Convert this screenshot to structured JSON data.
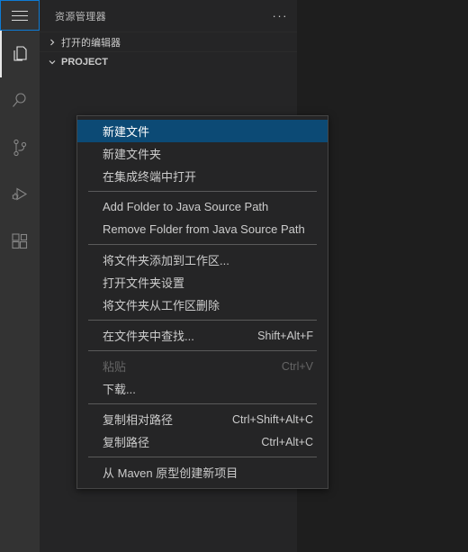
{
  "activitybar": {
    "menu_icon": "hamburger-icon",
    "items": [
      {
        "name": "explorer",
        "icon": "files-icon",
        "active": true
      },
      {
        "name": "search",
        "icon": "search-icon",
        "active": false
      },
      {
        "name": "source-control",
        "icon": "git-branch-icon",
        "active": false
      },
      {
        "name": "run-debug",
        "icon": "run-debug-icon",
        "active": false
      },
      {
        "name": "extensions",
        "icon": "extensions-icon",
        "active": false
      }
    ]
  },
  "sidebar": {
    "title": "资源管理器",
    "actions_label": "···",
    "tree": [
      {
        "label": "打开的编辑器",
        "expanded": false,
        "bold": false
      },
      {
        "label": "PROJECT",
        "expanded": true,
        "bold": true
      }
    ]
  },
  "context_menu": {
    "items": [
      {
        "type": "item",
        "label": "新建文件",
        "shortcut": "",
        "selected": true,
        "disabled": false
      },
      {
        "type": "item",
        "label": "新建文件夹",
        "shortcut": "",
        "selected": false,
        "disabled": false
      },
      {
        "type": "item",
        "label": "在集成终端中打开",
        "shortcut": "",
        "selected": false,
        "disabled": false
      },
      {
        "type": "separator"
      },
      {
        "type": "item",
        "label": "Add Folder to Java Source Path",
        "shortcut": "",
        "selected": false,
        "disabled": false
      },
      {
        "type": "item",
        "label": "Remove Folder from Java Source Path",
        "shortcut": "",
        "selected": false,
        "disabled": false
      },
      {
        "type": "separator"
      },
      {
        "type": "item",
        "label": "将文件夹添加到工作区...",
        "shortcut": "",
        "selected": false,
        "disabled": false
      },
      {
        "type": "item",
        "label": "打开文件夹设置",
        "shortcut": "",
        "selected": false,
        "disabled": false
      },
      {
        "type": "item",
        "label": "将文件夹从工作区删除",
        "shortcut": "",
        "selected": false,
        "disabled": false
      },
      {
        "type": "separator"
      },
      {
        "type": "item",
        "label": "在文件夹中查找...",
        "shortcut": "Shift+Alt+F",
        "selected": false,
        "disabled": false
      },
      {
        "type": "separator"
      },
      {
        "type": "item",
        "label": "粘贴",
        "shortcut": "Ctrl+V",
        "selected": false,
        "disabled": true
      },
      {
        "type": "item",
        "label": "下载...",
        "shortcut": "",
        "selected": false,
        "disabled": false
      },
      {
        "type": "separator"
      },
      {
        "type": "item",
        "label": "复制相对路径",
        "shortcut": "Ctrl+Shift+Alt+C",
        "selected": false,
        "disabled": false
      },
      {
        "type": "item",
        "label": "复制路径",
        "shortcut": "Ctrl+Alt+C",
        "selected": false,
        "disabled": false
      },
      {
        "type": "separator"
      },
      {
        "type": "item",
        "label": "从 Maven 原型创建新项目",
        "shortcut": "",
        "selected": false,
        "disabled": false
      }
    ]
  },
  "colors": {
    "activitybar_bg": "#333333",
    "sidebar_bg": "#252526",
    "editor_bg": "#1e1e1e",
    "menu_bg": "#252526",
    "menu_border": "#454545",
    "selection_blue": "#0c4a75",
    "focus_blue": "#0e7bd4",
    "text": "#cccccc",
    "text_disabled": "#656565",
    "separator": "#5a5a5a"
  }
}
